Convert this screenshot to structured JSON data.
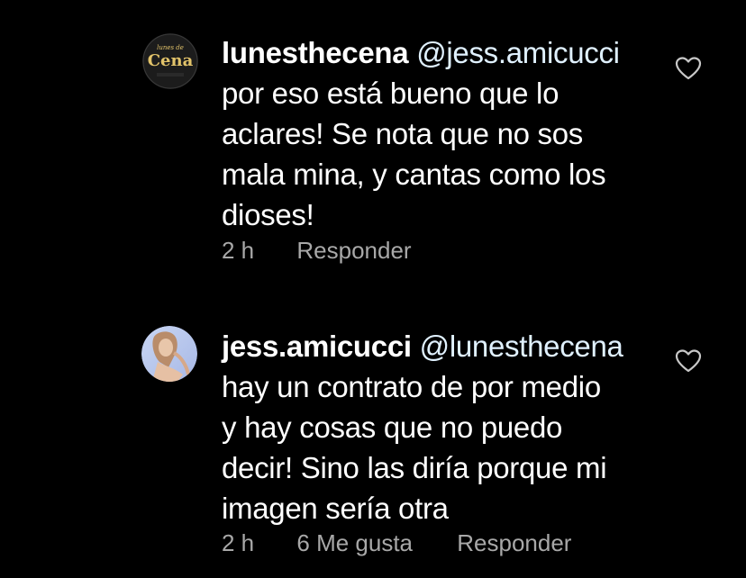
{
  "comments": [
    {
      "username": "lunesthecena",
      "mention": "@jess.amicucci",
      "lines": [
        "por eso está bueno que lo",
        "aclares! Se nota que no sos",
        "mala mina, y cantas como los",
        "dioses!"
      ],
      "time": "2 h",
      "likes": "",
      "reply_label": "Responder",
      "avatar": {
        "logo_text": "Cena",
        "logo_small": "lunes de",
        "icon": "logo-avatar"
      }
    },
    {
      "username": "jess.amicucci",
      "mention": "@lunesthecena",
      "lines": [
        "hay un contrato de por medio",
        "y hay cosas que no puedo",
        "decir! Sino las diría porque mi",
        "imagen sería otra"
      ],
      "time": "2 h",
      "likes": "6 Me gusta",
      "reply_label": "Responder",
      "avatar": {
        "icon": "profile-photo-avatar"
      }
    }
  ],
  "colors": {
    "background": "#000000",
    "text": "#ffffff",
    "meta": "#a8a8a8",
    "logo_gold": "#e2c36a"
  }
}
